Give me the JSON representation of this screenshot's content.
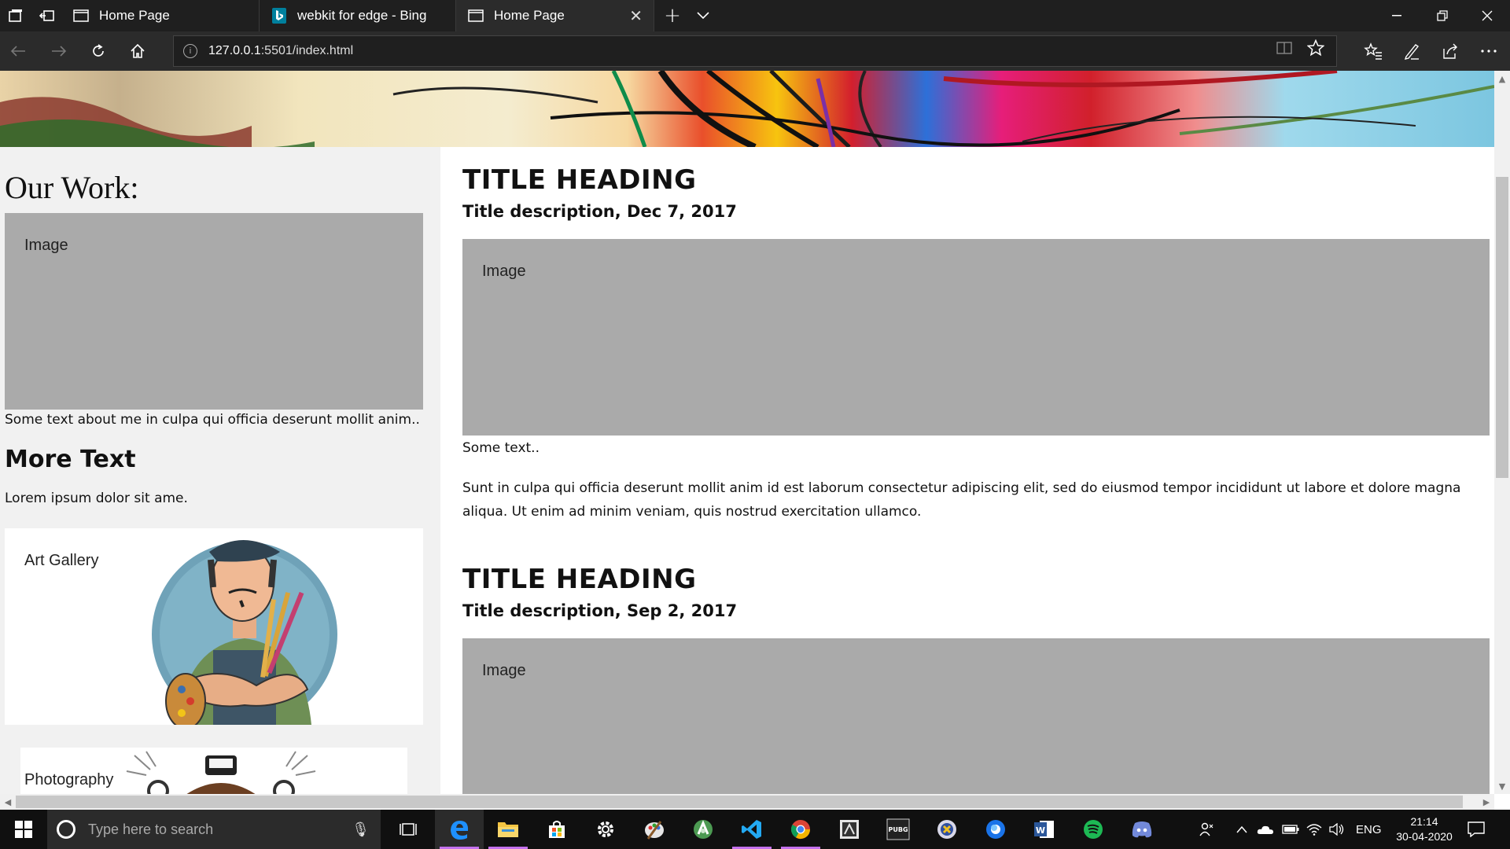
{
  "browser": {
    "tabs": [
      {
        "label": "Home Page",
        "icon": "page-icon",
        "active": false
      },
      {
        "label": "webkit for edge - Bing",
        "icon": "bing-icon",
        "active": false
      },
      {
        "label": "Home Page",
        "icon": "page-icon",
        "active": true
      }
    ],
    "new_tab_label": "+",
    "url_host": "127.0.0.1",
    "url_rest": ":5501/index.html"
  },
  "sidebar": {
    "heading": "Our Work:",
    "image_label": "Image",
    "about_text": "Some text about me in culpa qui officia deserunt mollit anim..",
    "more_heading": "More Text",
    "more_text": "Lorem ipsum dolor sit ame.",
    "cards": [
      {
        "label": "Art Gallery"
      },
      {
        "label": "Photography"
      }
    ]
  },
  "posts": [
    {
      "title": "TITLE HEADING",
      "description": "Title description, Dec 7, 2017",
      "image_label": "Image",
      "short_text": "Some text..",
      "body": "Sunt in culpa qui officia deserunt mollit anim id est laborum consectetur adipiscing elit, sed do eiusmod tempor incididunt ut labore et dolore magna aliqua. Ut enim ad minim veniam, quis nostrud exercitation ullamco."
    },
    {
      "title": "TITLE HEADING",
      "description": "Title description, Sep 2, 2017",
      "image_label": "Image"
    }
  ],
  "taskbar": {
    "search_placeholder": "Type here to search",
    "language": "ENG",
    "time": "21:14",
    "date": "30-04-2020",
    "apps": [
      "task-view-icon",
      "edge-icon",
      "file-explorer-icon",
      "store-icon",
      "settings-icon",
      "paint-icon",
      "android-studio-icon",
      "vscode-icon",
      "chrome-icon",
      "game-icon",
      "pubg-icon",
      "game2-icon",
      "browser2-icon",
      "word-icon",
      "spotify-icon",
      "discord-icon"
    ]
  },
  "colors": {
    "placeholder_gray": "#aaaaaa",
    "sidebar_bg": "#f1f1f1",
    "edge_blue": "#1e90ff",
    "active_underline": "#c471ed"
  }
}
